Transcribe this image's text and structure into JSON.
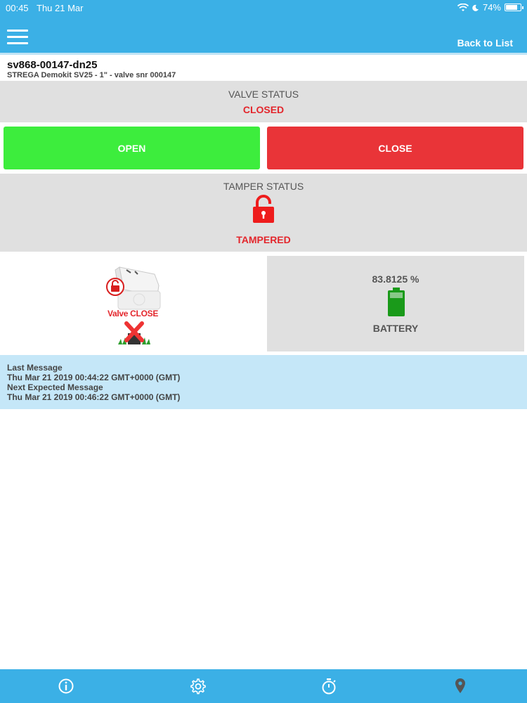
{
  "status_bar": {
    "time": "00:45",
    "date": "Thu 21 Mar",
    "battery": "74%"
  },
  "header": {
    "back_label": "Back to List"
  },
  "device": {
    "title": "sv868-00147-dn25",
    "subtitle": "STREGA Demokit SV25  - 1\" - valve snr 000147"
  },
  "valve": {
    "label": "VALVE STATUS",
    "value": "CLOSED",
    "open_label": "OPEN",
    "close_label": "CLOSE",
    "image_caption": "Valve CLOSE"
  },
  "tamper": {
    "label": "TAMPER STATUS",
    "value": "TAMPERED"
  },
  "battery": {
    "value": "83.8125 %",
    "label": "BATTERY",
    "level": 0.838
  },
  "messages": {
    "last_label": "Last Message",
    "last_value": "Thu Mar 21 2019 00:44:22 GMT+0000 (GMT)",
    "next_label": "Next Expected Message",
    "next_value": "Thu Mar 21 2019 00:46:22 GMT+0000 (GMT)"
  },
  "tabs": [
    {
      "icon": "info-icon"
    },
    {
      "icon": "gear-icon"
    },
    {
      "icon": "stopwatch-icon"
    },
    {
      "icon": "location-pin-icon"
    }
  ],
  "colors": {
    "primary": "#3bb0e6",
    "open": "#3ded3d",
    "close": "#e93438",
    "alert": "#e3262c",
    "battery": "#1a9a1a"
  }
}
